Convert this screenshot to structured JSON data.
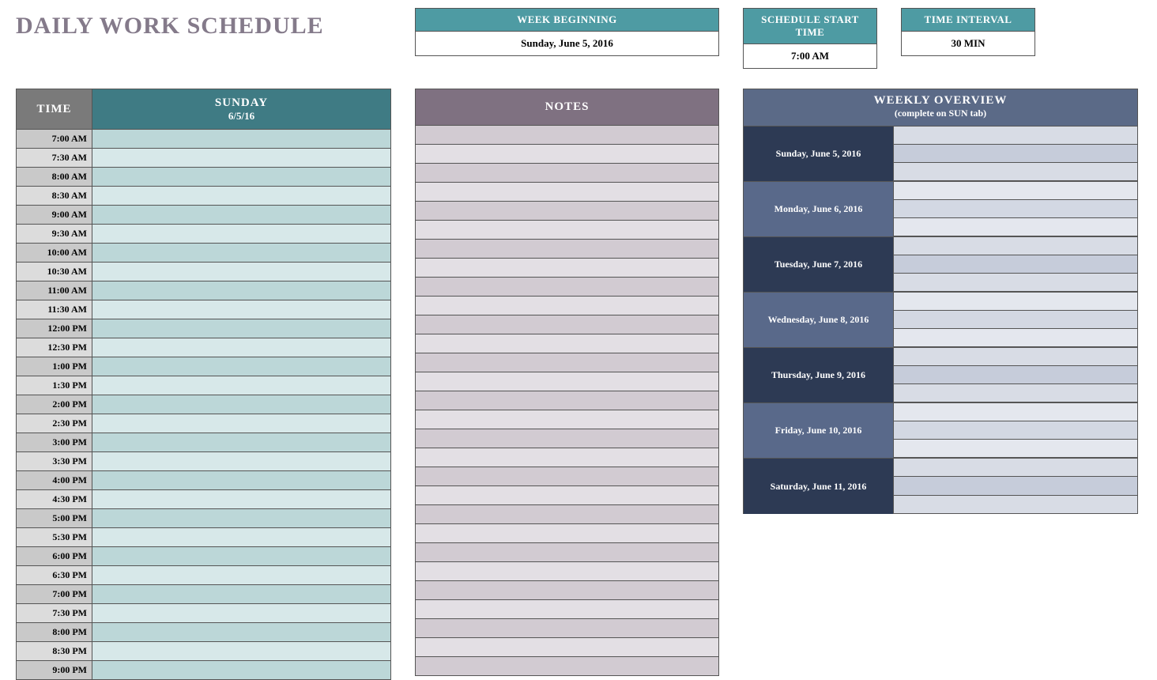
{
  "title": "DAILY WORK SCHEDULE",
  "info": {
    "week_begin_label": "WEEK BEGINNING",
    "week_begin_value": "Sunday, June 5, 2016",
    "start_time_label": "SCHEDULE START TIME",
    "start_time_value": "7:00 AM",
    "interval_label": "TIME INTERVAL",
    "interval_value": "30 MIN"
  },
  "schedule": {
    "time_header": "TIME",
    "day_name": "SUNDAY",
    "day_date": "6/5/16",
    "slots": [
      "7:00 AM",
      "7:30 AM",
      "8:00 AM",
      "8:30 AM",
      "9:00 AM",
      "9:30 AM",
      "10:00 AM",
      "10:30 AM",
      "11:00 AM",
      "11:30 AM",
      "12:00 PM",
      "12:30 PM",
      "1:00 PM",
      "1:30 PM",
      "2:00 PM",
      "2:30 PM",
      "3:00 PM",
      "3:30 PM",
      "4:00 PM",
      "4:30 PM",
      "5:00 PM",
      "5:30 PM",
      "6:00 PM",
      "6:30 PM",
      "7:00 PM",
      "7:30 PM",
      "8:00 PM",
      "8:30 PM",
      "9:00 PM"
    ]
  },
  "notes": {
    "header": "NOTES",
    "row_count": 29
  },
  "overview": {
    "header_main": "WEEKLY OVERVIEW",
    "header_sub": "(complete on SUN tab)",
    "days": [
      "Sunday, June 5, 2016",
      "Monday, June 6, 2016",
      "Tuesday, June 7, 2016",
      "Wednesday, June 8, 2016",
      "Thursday, June 9, 2016",
      "Friday, June 10, 2016",
      "Saturday, June 11, 2016"
    ]
  }
}
